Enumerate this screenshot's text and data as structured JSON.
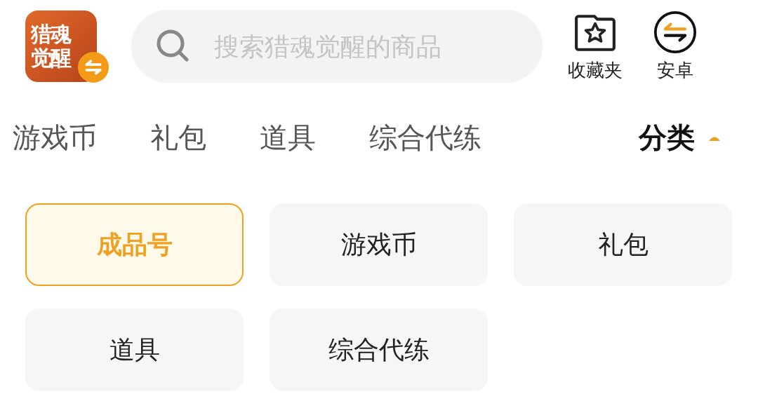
{
  "app_logo": {
    "lines": [
      "猎魂",
      "觉醒"
    ]
  },
  "search": {
    "placeholder": "搜索猎魂觉醒的商品"
  },
  "header_actions": [
    {
      "kind": "favorites",
      "label": "收藏夹"
    },
    {
      "kind": "platform",
      "label": "安卓"
    }
  ],
  "tabs": [
    {
      "label": "游戏币",
      "selected": false
    },
    {
      "label": "礼包",
      "selected": false
    },
    {
      "label": "道具",
      "selected": false
    },
    {
      "label": "综合代练",
      "selected": false
    }
  ],
  "category_menu": {
    "label": "分类",
    "expanded": true
  },
  "categories": [
    {
      "label": "成品号",
      "selected": true
    },
    {
      "label": "游戏币",
      "selected": false
    },
    {
      "label": "礼包",
      "selected": false
    },
    {
      "label": "道具",
      "selected": false
    },
    {
      "label": "综合代练",
      "selected": false
    }
  ]
}
